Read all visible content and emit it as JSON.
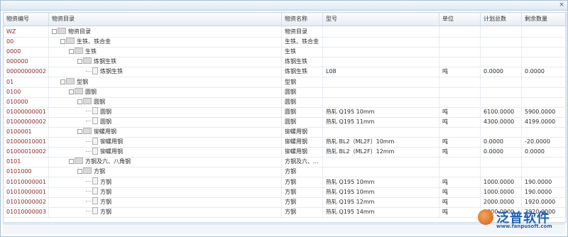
{
  "window": {
    "close_label": "×"
  },
  "columns": [
    "物资编号",
    "物资目录",
    "物资名称",
    "型号",
    "单位",
    "计划总数",
    "剩余数量"
  ],
  "rows": [
    {
      "code": "WZ",
      "level": 0,
      "kind": "folder",
      "tree": "物资目录",
      "name": "物资目录",
      "model": "",
      "unit": "",
      "plan": "",
      "remain": ""
    },
    {
      "code": "00",
      "level": 1,
      "kind": "folder",
      "tree": "生铁、铁合金",
      "name": "生铁、铁合金",
      "model": "",
      "unit": "",
      "plan": "",
      "remain": ""
    },
    {
      "code": "0000",
      "level": 2,
      "kind": "folder",
      "tree": "生铁",
      "name": "生铁",
      "model": "",
      "unit": "",
      "plan": "",
      "remain": ""
    },
    {
      "code": "000000",
      "level": 3,
      "kind": "folder",
      "tree": "炼钢生铁",
      "name": "炼钢生铁",
      "model": "",
      "unit": "",
      "plan": "",
      "remain": ""
    },
    {
      "code": "00000000002",
      "level": 4,
      "kind": "doc",
      "tree": "炼钢生铁",
      "name": "炼钢生铁",
      "model": "L08",
      "unit": "吨",
      "plan": "0.0000",
      "remain": "0.0000"
    },
    {
      "code": "01",
      "level": 1,
      "kind": "folder",
      "tree": "型钢",
      "name": "型钢",
      "model": "",
      "unit": "",
      "plan": "",
      "remain": ""
    },
    {
      "code": "0100",
      "level": 2,
      "kind": "folder",
      "tree": "圆钢",
      "name": "圆钢",
      "model": "",
      "unit": "",
      "plan": "",
      "remain": ""
    },
    {
      "code": "010000",
      "level": 3,
      "kind": "folder",
      "tree": "圆钢",
      "name": "圆钢",
      "model": "",
      "unit": "",
      "plan": "",
      "remain": ""
    },
    {
      "code": "01000000001",
      "level": 4,
      "kind": "doc",
      "tree": "圆钢",
      "name": "圆钢",
      "model": "热轧 Q195 10mm",
      "unit": "吨",
      "plan": "6100.0000",
      "remain": "5900.0000"
    },
    {
      "code": "01000000002",
      "level": 4,
      "kind": "doc",
      "tree": "圆钢",
      "name": "圆钢",
      "model": "热轧 Q195 11mm",
      "unit": "吨",
      "plan": "4300.0000",
      "remain": "4199.0000"
    },
    {
      "code": "0100001",
      "level": 3,
      "kind": "folder",
      "tree": "铆螺用钢",
      "name": "铆螺用钢",
      "model": "",
      "unit": "",
      "plan": "",
      "remain": ""
    },
    {
      "code": "01000010001",
      "level": 4,
      "kind": "doc",
      "tree": "铆螺用钢",
      "name": "铆螺用钢",
      "model": "热轧 BL2（ML2F）10mm",
      "unit": "吨",
      "plan": "0.0000",
      "remain": "-20.0000"
    },
    {
      "code": "01000010002",
      "level": 4,
      "kind": "doc",
      "tree": "铆螺用钢",
      "name": "铆螺用钢",
      "model": "热轧 BL2（ML2F）12mm",
      "unit": "吨",
      "plan": "0.0000",
      "remain": "0.0000"
    },
    {
      "code": "0101",
      "level": 2,
      "kind": "folder",
      "tree": "方钢及六、八角钢",
      "name": "方钢及六、...",
      "model": "",
      "unit": "",
      "plan": "",
      "remain": ""
    },
    {
      "code": "0101000",
      "level": 3,
      "kind": "folder",
      "tree": "方钢",
      "name": "方钢",
      "model": "",
      "unit": "",
      "plan": "",
      "remain": ""
    },
    {
      "code": "01010000001",
      "level": 4,
      "kind": "doc",
      "tree": "方钢",
      "name": "方钢",
      "model": "热轧 Q195 10mm",
      "unit": "吨",
      "plan": "1000.0000",
      "remain": "190.0000"
    },
    {
      "code": "01010000001",
      "level": 4,
      "kind": "doc",
      "tree": "方钢",
      "name": "方钢",
      "model": "热轧 Q195 10mm",
      "unit": "吨",
      "plan": "1000.0000",
      "remain": "190.0000"
    },
    {
      "code": "01010000002",
      "level": 4,
      "kind": "doc",
      "tree": "方钢",
      "name": "方钢",
      "model": "热轧 Q195 12mm",
      "unit": "吨",
      "plan": "2000.0000",
      "remain": "1920.0000"
    },
    {
      "code": "01010000003",
      "level": 4,
      "kind": "doc",
      "tree": "方钢",
      "name": "方钢",
      "model": "热轧 Q195 14mm",
      "unit": "吨",
      "plan": "3000.0000",
      "remain": "2920.0000"
    }
  ],
  "watermark": {
    "brand": "泛普软件",
    "url": "www.fanpusoft.com"
  }
}
